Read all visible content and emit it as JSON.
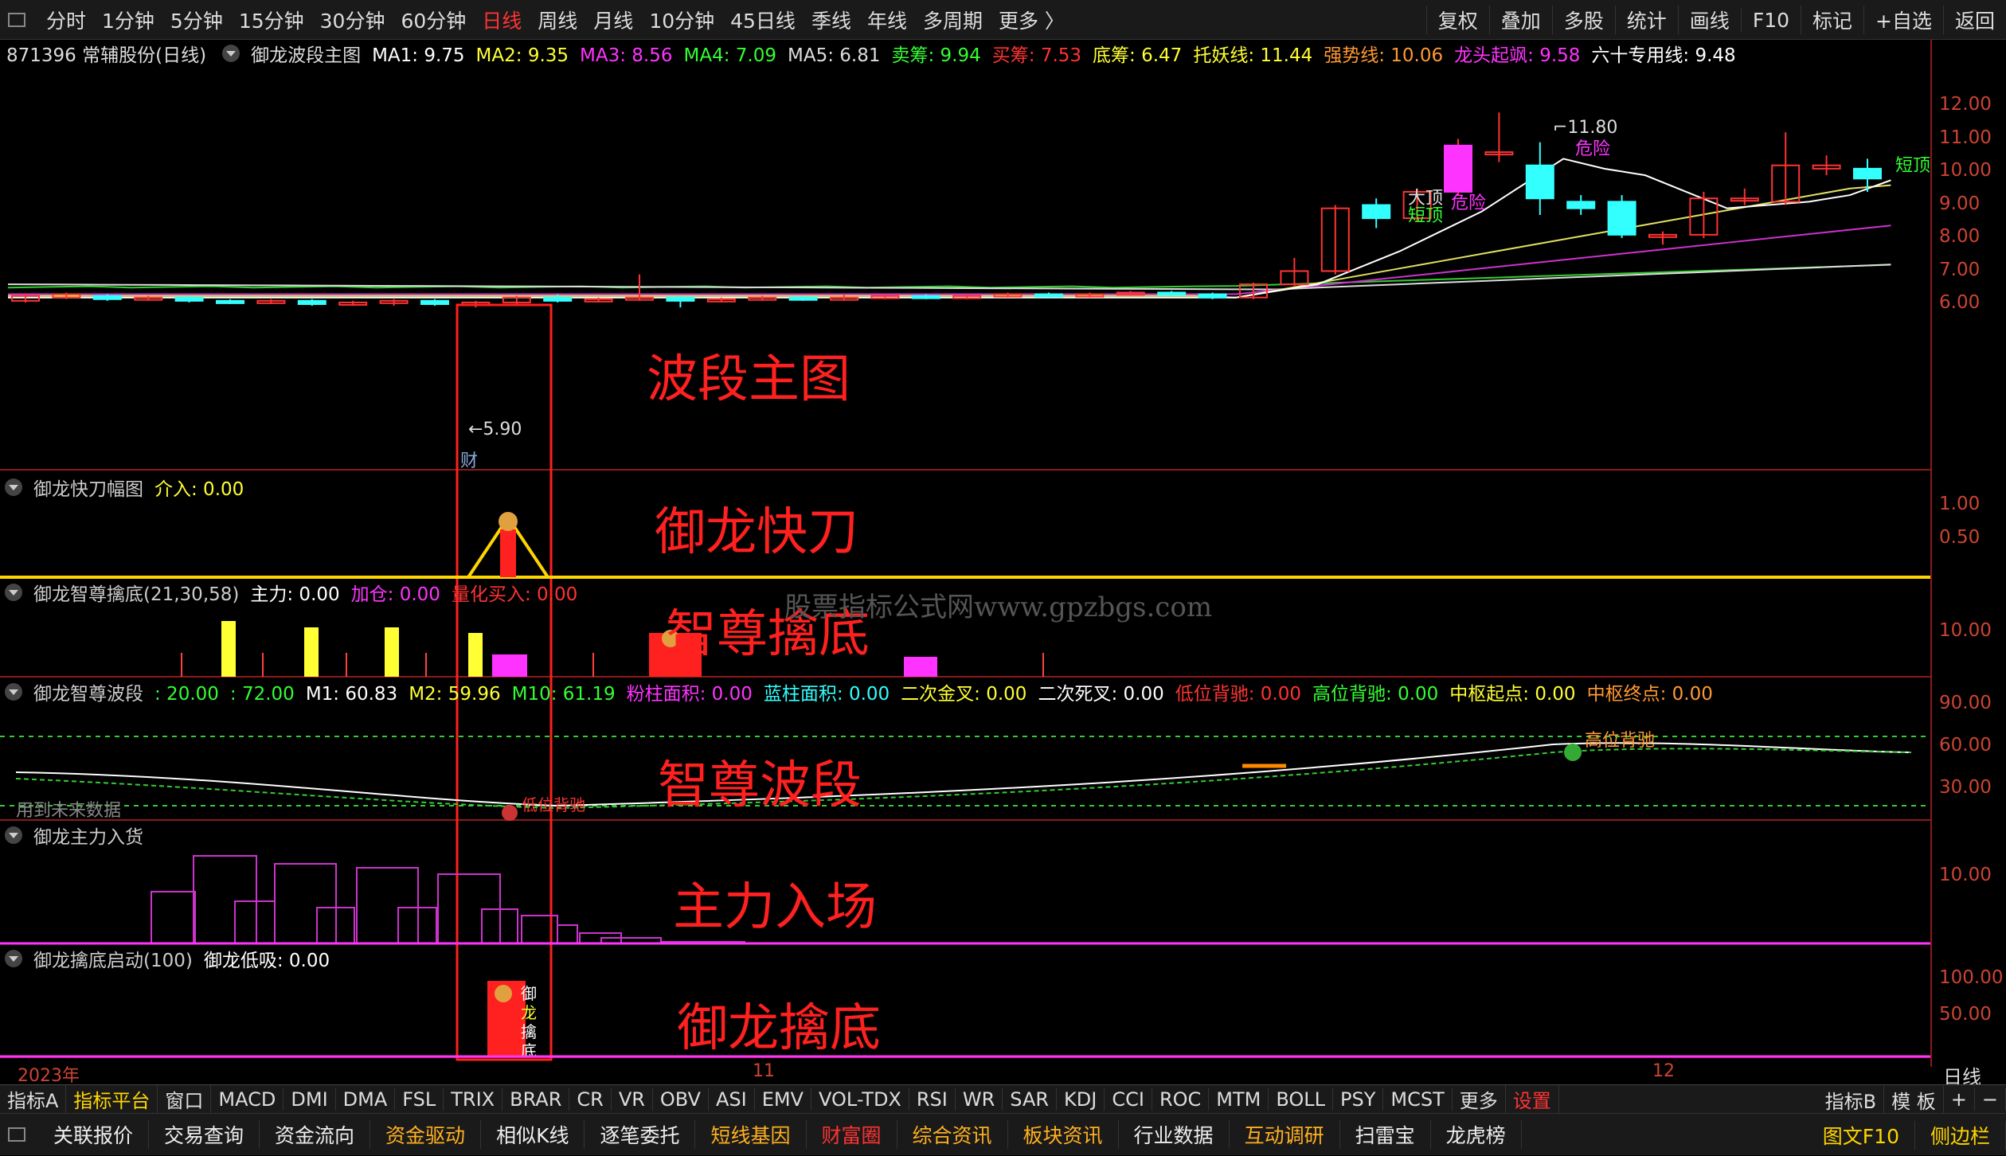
{
  "topbar": {
    "periods": [
      "分时",
      "1分钟",
      "5分钟",
      "15分钟",
      "30分钟",
      "60分钟",
      "日线",
      "周线",
      "月线",
      "10分钟",
      "45日线",
      "季线",
      "年线",
      "多周期",
      "更多 〉"
    ],
    "active_period": "日线",
    "right": [
      "复权",
      "叠加",
      "多股",
      "统计",
      "画线",
      "F10",
      "标记",
      "+自选",
      "返回"
    ]
  },
  "main_info": {
    "stock": "871396 常辅股份(日线)",
    "indicator": "御龙波段主图",
    "ma": [
      {
        "label": "MA1: 9.75",
        "color": "#ffffff"
      },
      {
        "label": "MA2: 9.35",
        "color": "#ffff33"
      },
      {
        "label": "MA3: 8.56",
        "color": "#ff33ff"
      },
      {
        "label": "MA4: 7.09",
        "color": "#33ff33"
      },
      {
        "label": "MA5: 6.81",
        "color": "#dddddd"
      },
      {
        "label": "卖筹: 9.94",
        "color": "#33ff33"
      },
      {
        "label": "买筹: 7.53",
        "color": "#ff3333"
      },
      {
        "label": "底筹: 6.47",
        "color": "#ffff33"
      },
      {
        "label": "托妖线: 11.44",
        "color": "#ffff33"
      },
      {
        "label": "强势线: 10.06",
        "color": "#ff9933"
      },
      {
        "label": "龙头起飒: 9.58",
        "color": "#ff33ff"
      },
      {
        "label": "六十专用线: 9.48",
        "color": "#ffffff"
      }
    ]
  },
  "main_axis": [
    "12.00",
    "11.00",
    "10.00",
    "9.00",
    "8.00",
    "7.00",
    "6.00"
  ],
  "annotations": {
    "high": "11.80",
    "low": "5.90",
    "cai": "财",
    "danger1": "危险",
    "danger2": "危险",
    "top": "大顶",
    "short_top": "短顶",
    "short_end": "短顶",
    "high_diverge": "高位背驰",
    "low_diverge": "低位背驰",
    "future_data": "用到未来数据",
    "watermark": "股票指标公式网www.gpzbgs.com",
    "stamp": [
      "御",
      "龙",
      "擒",
      "底"
    ]
  },
  "panels": {
    "kuaidao": {
      "title": "御龙快刀幅图",
      "items": [
        {
          "label": "介入: 0.00",
          "color": "#ffff33"
        }
      ],
      "axis": [
        "1.00",
        "0.50"
      ]
    },
    "qindi": {
      "title": "御龙智尊擒底(21,30,58)",
      "items": [
        {
          "label": "主力: 0.00",
          "color": "#ffffff"
        },
        {
          "label": "加仓: 0.00",
          "color": "#ff33ff"
        },
        {
          "label": "量化买入: 0.00",
          "color": "#ff3333"
        }
      ],
      "axis": [
        "10.00"
      ]
    },
    "boduan": {
      "title": "御龙智尊波段",
      "items": [
        {
          "label": ": 20.00",
          "color": "#33ff33"
        },
        {
          "label": ": 72.00",
          "color": "#33ff33"
        },
        {
          "label": "M1: 60.83",
          "color": "#ffffff"
        },
        {
          "label": "M2: 59.96",
          "color": "#ffff33"
        },
        {
          "label": "M10: 61.19",
          "color": "#33ff33"
        },
        {
          "label": "粉柱面积: 0.00",
          "color": "#ff33ff"
        },
        {
          "label": "蓝柱面积: 0.00",
          "color": "#33ffff"
        },
        {
          "label": "二次金叉: 0.00",
          "color": "#ffff33"
        },
        {
          "label": "二次死叉: 0.00",
          "color": "#ffffff"
        },
        {
          "label": "低位背驰: 0.00",
          "color": "#ff3333"
        },
        {
          "label": "高位背驰: 0.00",
          "color": "#33ff33"
        },
        {
          "label": "中枢起点: 0.00",
          "color": "#ffff33"
        },
        {
          "label": "中枢终点: 0.00",
          "color": "#ff9933"
        }
      ],
      "axis": [
        "90.00",
        "60.00",
        "30.00"
      ]
    },
    "ruhuo": {
      "title": "御龙主力入货",
      "items": [],
      "axis": [
        "10.00"
      ]
    },
    "qidong": {
      "title": "御龙擒底启动(100)",
      "items": [
        {
          "label": "御龙低吸: 0.00",
          "color": "#ffffff"
        }
      ],
      "axis": [
        "100.00",
        "50.00"
      ]
    }
  },
  "labels_big": [
    "波段主图",
    "御龙快刀",
    "智尊擒底",
    "智尊波段",
    "主力入场",
    "御龙擒底"
  ],
  "dates": {
    "year": "2023年",
    "m11": "11",
    "m12": "12",
    "period": "日线"
  },
  "bottom_tabs": [
    "指标A",
    "指标平台",
    "窗口",
    "MACD",
    "DMI",
    "DMA",
    "FSL",
    "TRIX",
    "BRAR",
    "CR",
    "VR",
    "OBV",
    "ASI",
    "EMV",
    "VOL-TDX",
    "RSI",
    "WR",
    "SAR",
    "KDJ",
    "CCI",
    "ROC",
    "MTM",
    "BOLL",
    "PSY",
    "MCST",
    "更多",
    "设置"
  ],
  "bottom_right": [
    "指标B",
    "模 板",
    "+",
    "−"
  ],
  "bottom_bar2": [
    "关联报价",
    "交易查询",
    "资金流向",
    "资金驱动",
    "相似K线",
    "逐笔委托",
    "短线基因",
    "财富圈",
    "综合资讯",
    "板块资讯",
    "行业数据",
    "互动调研",
    "扫雷宝",
    "龙虎榜"
  ],
  "bottom_bar2_right": [
    "图文F10",
    "侧边栏"
  ]
}
